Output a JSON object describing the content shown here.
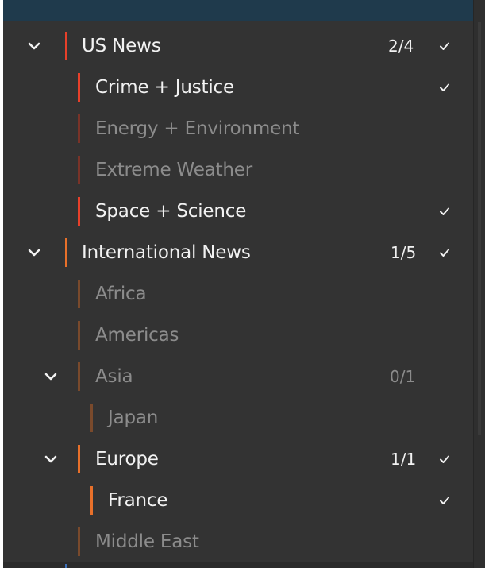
{
  "tree": {
    "us_news": {
      "label": "US News",
      "count": "2/4"
    },
    "crime_justice": {
      "label": "Crime + Justice"
    },
    "energy_environment": {
      "label": "Energy + Environment"
    },
    "extreme_weather": {
      "label": "Extreme Weather"
    },
    "space_science": {
      "label": "Space + Science"
    },
    "international_news": {
      "label": "International News",
      "count": "1/5"
    },
    "africa": {
      "label": "Africa"
    },
    "americas": {
      "label": "Americas"
    },
    "asia": {
      "label": "Asia",
      "count": "0/1"
    },
    "japan": {
      "label": "Japan"
    },
    "europe": {
      "label": "Europe",
      "count": "1/1"
    },
    "france": {
      "label": "France"
    },
    "middle_east": {
      "label": "Middle East"
    }
  },
  "colors": {
    "panel_bg": "#333333",
    "top_bar": "#1f3a4c",
    "us_news_accent": "#e8402a",
    "international_accent": "#e8702a",
    "active_text": "#f2f2f2",
    "inactive_text": "#8c8c8c"
  },
  "icons": {
    "expand": "chevron-down-icon",
    "selected": "checkmark-icon"
  }
}
